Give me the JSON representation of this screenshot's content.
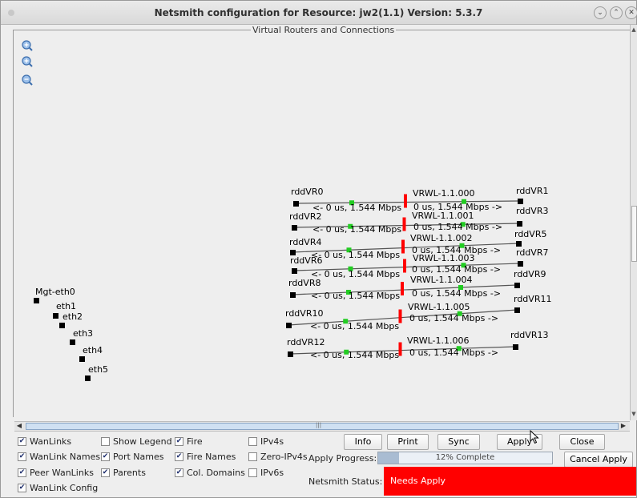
{
  "window": {
    "title": "Netsmith configuration for Resource:  jw2(1.1)  Version: 5.3.7",
    "controls": [
      "minimize-icon",
      "maximize-icon",
      "close-icon"
    ]
  },
  "canvas": {
    "group_title": "Virtual Routers and Connections",
    "zoom_icons": [
      "zoom-in-icon",
      "zoom-reset-icon",
      "zoom-out-icon"
    ],
    "local_ports": [
      "Mgt-eth0",
      "eth1",
      "eth2",
      "eth3",
      "eth4",
      "eth5"
    ],
    "wanlinks": [
      {
        "name": "VRWL-1.1.000",
        "left": "rddVR0",
        "right": "rddVR1",
        "left_rate": "<- 0 us, 1.544 Mbps",
        "right_rate": "0 us, 1.544 Mbps ->"
      },
      {
        "name": "VRWL-1.1.001",
        "left": "rddVR2",
        "right": "rddVR3",
        "left_rate": "<- 0 us, 1.544 Mbps",
        "right_rate": "0 us, 1.544 Mbps ->"
      },
      {
        "name": "VRWL-1.1.002",
        "left": "rddVR4",
        "right": "rddVR5",
        "left_rate": "<- 0 us, 1.544 Mbps",
        "right_rate": "0 us, 1.544 Mbps ->"
      },
      {
        "name": "VRWL-1.1.003",
        "left": "rddVR6",
        "right": "rddVR7",
        "left_rate": "<- 0 us, 1.544 Mbps",
        "right_rate": "0 us, 1.544 Mbps ->"
      },
      {
        "name": "VRWL-1.1.004",
        "left": "rddVR8",
        "right": "rddVR9",
        "left_rate": "<- 0 us, 1.544 Mbps",
        "right_rate": "0 us, 1.544 Mbps ->"
      },
      {
        "name": "VRWL-1.1.005",
        "left": "rddVR10",
        "right": "rddVR11",
        "left_rate": "<- 0 us, 1.544 Mbps",
        "right_rate": "0 us, 1.544 Mbps ->"
      },
      {
        "name": "VRWL-1.1.006",
        "left": "rddVR12",
        "right": "rddVR13",
        "left_rate": "<- 0 us, 1.544 Mbps",
        "right_rate": "0 us, 1.544 Mbps ->"
      }
    ]
  },
  "options": {
    "wanlinks": "WanLinks",
    "show_legend": "Show Legend",
    "fire": "Fire",
    "ipv4s": "IPv4s",
    "wanlink_names": "WanLink Names",
    "port_names": "Port Names",
    "fire_names": "Fire Names",
    "zero_ipv4s": "Zero-IPv4s",
    "peer_wanlinks": "Peer WanLinks",
    "parents": "Parents",
    "col_domains": "Col. Domains",
    "ipv6s": "IPv6s",
    "wanlink_config": "WanLink Config",
    "checked": {
      "wanlinks": true,
      "show_legend": false,
      "fire": true,
      "ipv4s": false,
      "wanlink_names": true,
      "port_names": true,
      "fire_names": true,
      "zero_ipv4s": false,
      "peer_wanlinks": true,
      "parents": true,
      "col_domains": true,
      "ipv6s": false,
      "wanlink_config": true
    }
  },
  "buttons": {
    "info": "Info",
    "print": "Print",
    "sync": "Sync",
    "apply": "Apply",
    "close": "Close",
    "cancel_apply": "Cancel Apply"
  },
  "apply_progress": {
    "label": "Apply Progress:",
    "percent": 12,
    "text": "12% Complete"
  },
  "netsmith_status": {
    "label": "Netsmith Status:",
    "value": "Needs Apply"
  },
  "colors": {
    "status_bg": "#ff0000",
    "firewall": "#ff0000",
    "link_midpoint": "#22cc22",
    "node": "#000000"
  }
}
